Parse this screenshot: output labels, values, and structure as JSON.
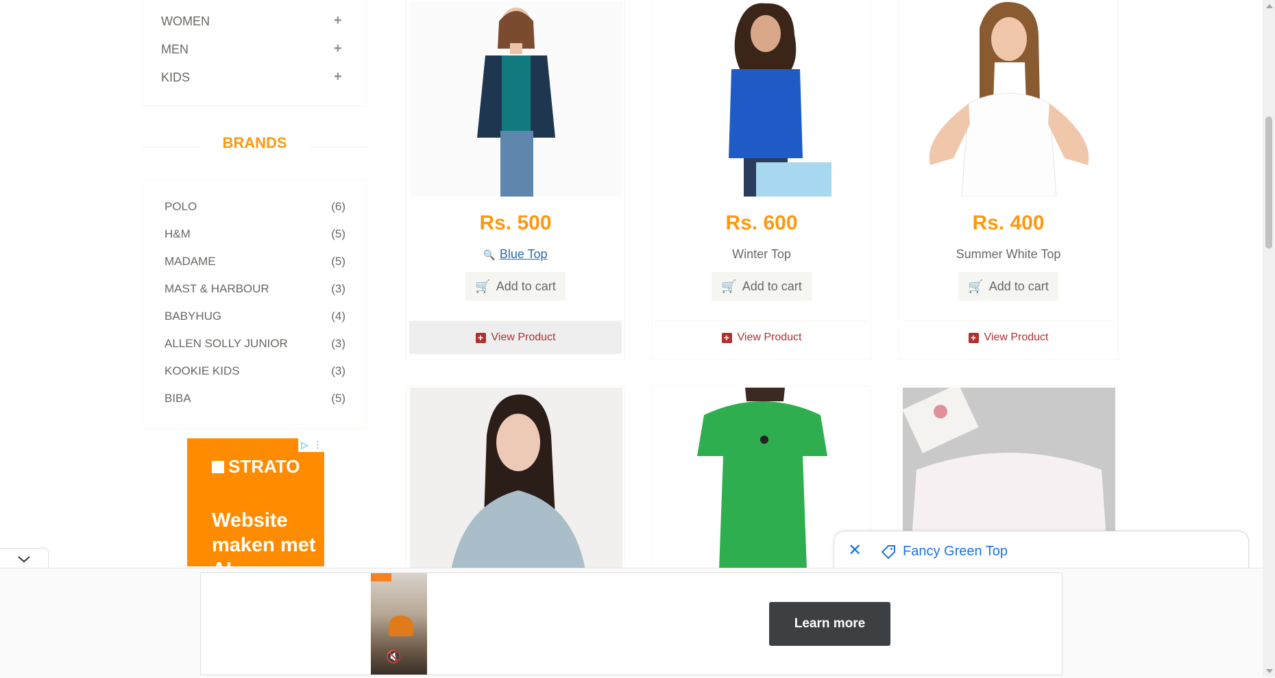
{
  "categories": [
    {
      "label": "WOMEN",
      "expand": "+"
    },
    {
      "label": "MEN",
      "expand": "+"
    },
    {
      "label": "KIDS",
      "expand": "+"
    }
  ],
  "brands_title": "BRANDS",
  "brands": [
    {
      "name": "POLO",
      "count": "(6)"
    },
    {
      "name": "H&M",
      "count": "(5)"
    },
    {
      "name": "MADAME",
      "count": "(5)"
    },
    {
      "name": "MAST & HARBOUR",
      "count": "(3)"
    },
    {
      "name": "BABYHUG",
      "count": "(4)"
    },
    {
      "name": "ALLEN SOLLY JUNIOR",
      "count": "(3)"
    },
    {
      "name": "KOOKIE KIDS",
      "count": "(3)"
    },
    {
      "name": "BIBA",
      "count": "(5)"
    }
  ],
  "left_ad": {
    "brand": "STRATO",
    "text": "Website maken met AI"
  },
  "products": [
    {
      "price": "Rs. 500",
      "name": "Blue Top",
      "cart_label": "Add to cart",
      "view_label": "View Product"
    },
    {
      "price": "Rs. 600",
      "name": "Winter Top",
      "cart_label": "Add to cart",
      "view_label": "View Product"
    },
    {
      "price": "Rs. 400",
      "name": "Summer White Top",
      "cart_label": "Add to cart",
      "view_label": "View Product"
    }
  ],
  "popup": {
    "label": "Fancy Green Top"
  },
  "bottom_ad": {
    "cta": "Learn more"
  },
  "colors": {
    "accent": "#fe980f",
    "link": "#1a73e8",
    "view_product": "#b03030"
  }
}
